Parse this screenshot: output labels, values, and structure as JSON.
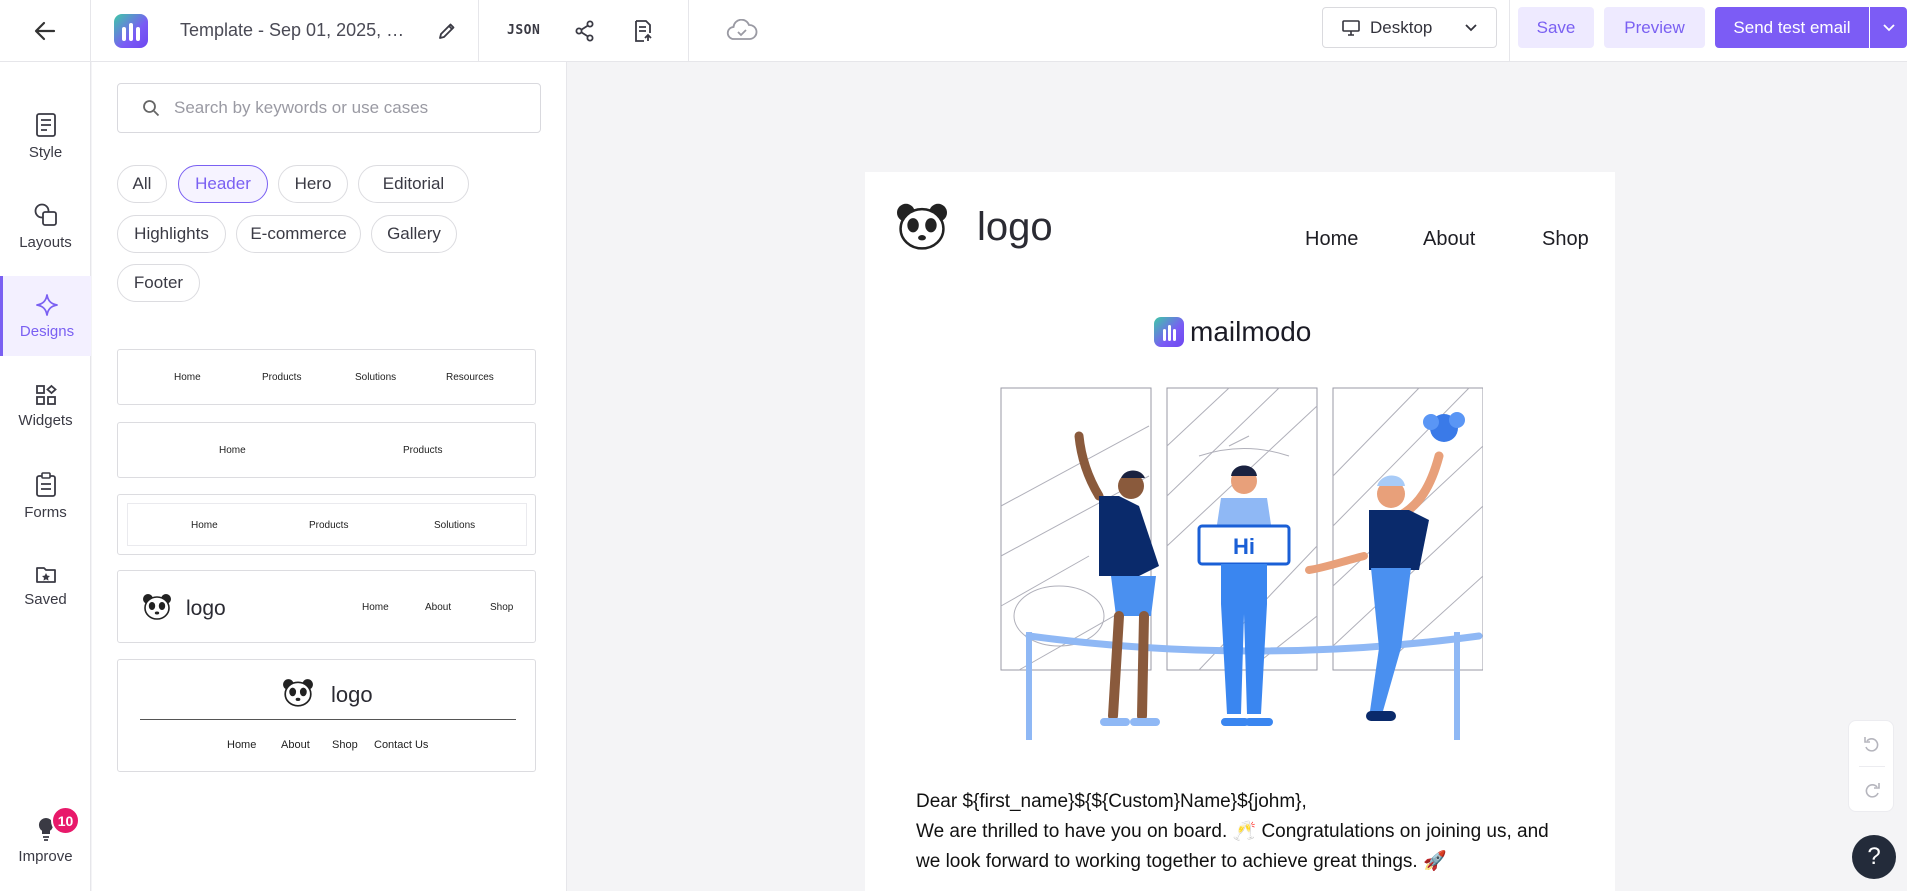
{
  "header": {
    "template_title": "Template - Sep 01, 2025, 0...",
    "json_label": "JSON",
    "device": "Desktop",
    "save_label": "Save",
    "preview_label": "Preview",
    "send_label": "Send test email"
  },
  "rail": {
    "items": [
      {
        "label": "Style",
        "icon": "style-icon"
      },
      {
        "label": "Layouts",
        "icon": "layouts-icon"
      },
      {
        "label": "Designs",
        "icon": "sparkle-icon",
        "active": true
      },
      {
        "label": "Widgets",
        "icon": "widgets-icon"
      },
      {
        "label": "Forms",
        "icon": "forms-icon"
      },
      {
        "label": "Saved",
        "icon": "saved-folder-icon"
      }
    ],
    "improve": {
      "label": "Improve",
      "badge": "10"
    }
  },
  "panel": {
    "search_placeholder": "Search by keywords or use cases",
    "chips": [
      "All",
      "Header",
      "Hero",
      "Editorial",
      "Highlights",
      "E-commerce",
      "Gallery",
      "Footer"
    ],
    "active_chip": "Header",
    "cards": [
      {
        "links": [
          "Home",
          "Products",
          "Solutions",
          "Resources"
        ]
      },
      {
        "links": [
          "Home",
          "Products"
        ]
      },
      {
        "links": [
          "Home",
          "Products",
          "Solutions"
        ]
      },
      {
        "logo": "logo",
        "links": [
          "Home",
          "About",
          "Shop"
        ]
      },
      {
        "logo": "logo",
        "links": [
          "Home",
          "About",
          "Shop",
          "Contact Us"
        ]
      }
    ]
  },
  "email": {
    "logo_text": "logo",
    "nav": [
      "Home",
      "About",
      "Shop"
    ],
    "brand": "mailmodo",
    "sign_text": "Hi",
    "line1": "Dear ${first_name}${${Custom}Name}${johm},",
    "line2": "We are thrilled to have you on board. 🥂 Congratulations on joining us, and",
    "line3": "we look forward to working together to achieve great things. 🚀"
  },
  "colors": {
    "accent": "#7c5cf5",
    "accent_soft": "#eeeaff",
    "badge": "#e8196a"
  }
}
